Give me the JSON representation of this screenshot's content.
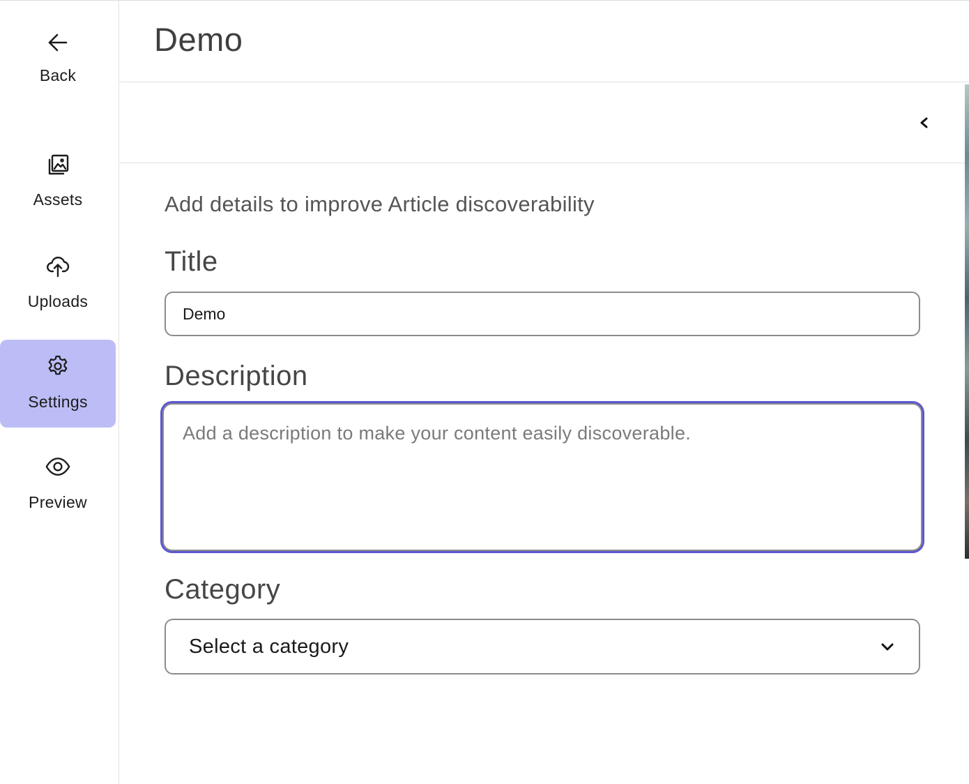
{
  "header": {
    "title": "Demo"
  },
  "sidebar": {
    "items": [
      {
        "label": "Back",
        "icon": "arrow-left-icon"
      },
      {
        "label": "Assets",
        "icon": "images-icon"
      },
      {
        "label": "Uploads",
        "icon": "cloud-upload-icon"
      },
      {
        "label": "Settings",
        "icon": "gear-icon",
        "active": true
      },
      {
        "label": "Preview",
        "icon": "eye-icon"
      }
    ]
  },
  "toolbar": {
    "collapse_icon": "chevron-left-icon"
  },
  "form": {
    "intro": "Add details to improve Article discoverability",
    "title_label": "Title",
    "title_value": "Demo",
    "description_label": "Description",
    "description_placeholder": "Add a description to make your content easily discoverable.",
    "description_value": "",
    "category_label": "Category",
    "category_selected": "Select a category"
  },
  "colors": {
    "active_nav_bg": "#bcbdf6",
    "focus_ring": "#5b57d1",
    "border": "#8b8b8b"
  }
}
